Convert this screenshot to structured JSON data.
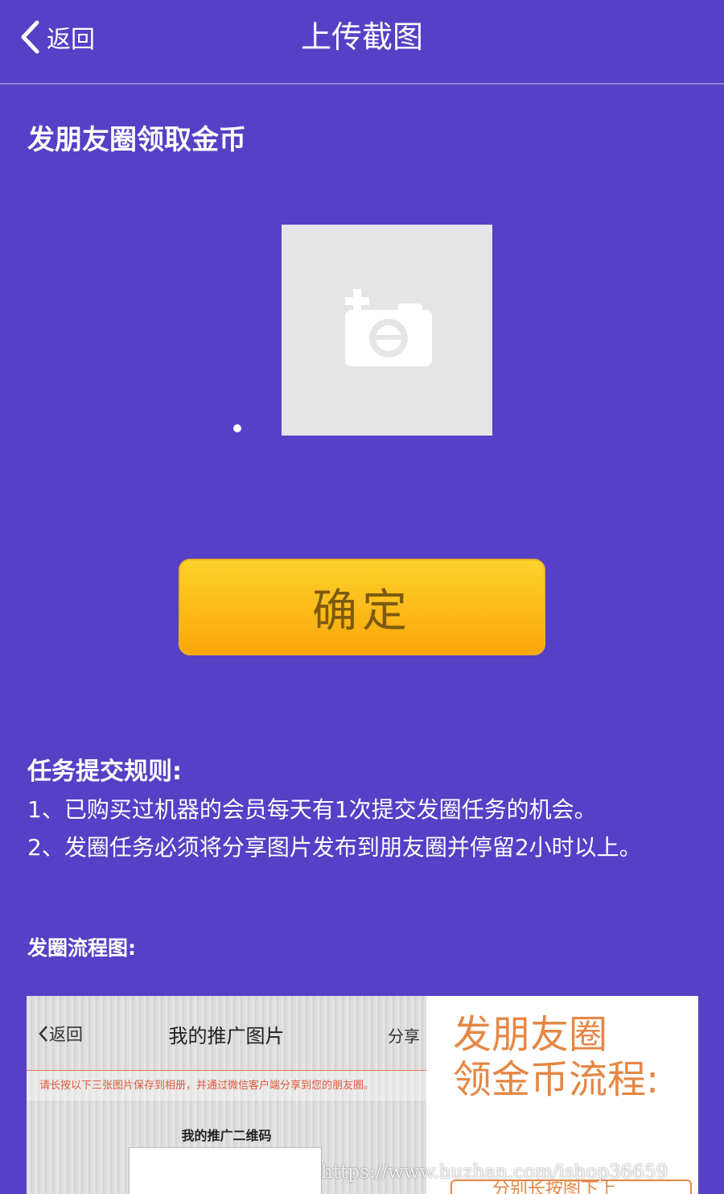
{
  "navbar": {
    "back_label": "返回",
    "title": "上传截图"
  },
  "section": {
    "title": "发朋友圈领取金币"
  },
  "upload": {
    "icon": "add-photo-camera-icon"
  },
  "confirm_button": {
    "label": "确定"
  },
  "rules": {
    "title": "任务提交规则:",
    "items": [
      "1、已购买过机器的会员每天有1次提交发圈任务的机会。",
      "2、发圈任务必须将分享图片发布到朋友圈并停留2小时以上。"
    ]
  },
  "flow": {
    "title": "发圈流程图:",
    "image": {
      "phone_back": "返回",
      "phone_title": "我的推广图片",
      "phone_share": "分享",
      "phone_hint": "请长按以下三张图片保存到相册，并通过微信客户端分享到您的朋友圈。",
      "phone_qr_label": "我的推广二维码",
      "heading_line1": "发朋友圈",
      "heading_line2": "领金币流程:",
      "sub_label": "分别长按图下上"
    }
  },
  "watermark": "https://www.huzhan.com/ishop36659",
  "colors": {
    "background": "#5540c6",
    "button_top": "#fcd22b",
    "button_bottom": "#fba60a",
    "button_text": "#7d5a10",
    "flow_accent": "#e58745"
  }
}
